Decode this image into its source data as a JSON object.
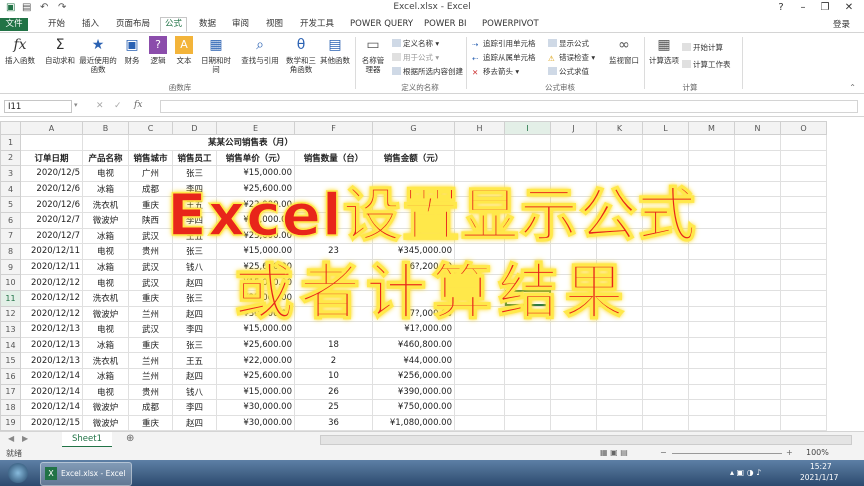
{
  "window": {
    "title": "Excel.xlsx - Excel",
    "login": "登录"
  },
  "tabs": [
    "文件",
    "开始",
    "插入",
    "页面布局",
    "公式",
    "数据",
    "审阅",
    "视图",
    "开发工具",
    "POWER QUERY",
    "POWER BI",
    "POWERPIVOT"
  ],
  "ribbon": {
    "insert_function": "插入函数",
    "autosum": "自动求和",
    "recent": "最近使用的函数",
    "financial": "财务",
    "logical": "逻辑",
    "text": "文本",
    "datetime": "日期和时间",
    "lookup": "查找与引用",
    "math": "数学和三角函数",
    "more": "其他函数",
    "name_manager": "名称管理器",
    "define_name": "定义名称",
    "use_in_formula": "用于公式",
    "create_from_selection": "根据所选内容创建",
    "trace_precedents": "追踪引用单元格",
    "trace_dependents": "追踪从属单元格",
    "remove_arrows": "移去箭头",
    "show_formulas": "显示公式",
    "error_checking": "错误检查",
    "evaluate_formula": "公式求值",
    "watch_window": "监视窗口",
    "calc_options": "计算选项",
    "calc_now": "开始计算",
    "calc_sheet": "计算工作表",
    "group_library": "函数库",
    "group_names": "定义的名称",
    "group_audit": "公式审核",
    "group_calc": "计算"
  },
  "formula_bar": {
    "name_box": "I11",
    "fx": "fx",
    "value": ""
  },
  "columns": [
    "A",
    "B",
    "C",
    "D",
    "E",
    "F",
    "G",
    "H",
    "I",
    "J",
    "K",
    "L",
    "M",
    "N",
    "O"
  ],
  "sheet": {
    "title": "某某公司销售表（月）",
    "headers": [
      "订单日期",
      "产品名称",
      "销售城市",
      "销售员工",
      "销售单价（元）",
      "销售数量（台）",
      "销售金额（元）"
    ],
    "rows": [
      [
        "2020/12/5",
        "电视",
        "广州",
        "张三",
        "¥15,000.00",
        "",
        ""
      ],
      [
        "2020/12/6",
        "冰箱",
        "成都",
        "李四",
        "¥25,600.00",
        "",
        ""
      ],
      [
        "2020/12/6",
        "洗衣机",
        "重庆",
        "王五",
        "¥22,000.00",
        "",
        ""
      ],
      [
        "2020/12/7",
        "微波炉",
        "陕西",
        "李四",
        "¥30,000.00",
        "",
        ""
      ],
      [
        "2020/12/7",
        "冰箱",
        "武汉",
        "王五",
        "¥25,600.00",
        "",
        ""
      ],
      [
        "2020/12/11",
        "电视",
        "贵州",
        "张三",
        "¥15,000.00",
        "23",
        "¥345,000.00"
      ],
      [
        "2020/12/11",
        "冰箱",
        "武汉",
        "钱八",
        "¥25,600.00",
        "",
        "¥6?,200.00"
      ],
      [
        "2020/12/12",
        "电视",
        "武汉",
        "赵四",
        "¥15,000.00",
        "",
        ""
      ],
      [
        "2020/12/12",
        "洗衣机",
        "重庆",
        "张三",
        "¥22,000.00",
        "",
        ""
      ],
      [
        "2020/12/12",
        "微波炉",
        "兰州",
        "赵四",
        "¥30,000.00",
        "",
        "¥7?,000.00"
      ],
      [
        "2020/12/13",
        "电视",
        "武汉",
        "李四",
        "¥15,000.00",
        "",
        "¥1?,000.00"
      ],
      [
        "2020/12/13",
        "冰箱",
        "重庆",
        "张三",
        "¥25,600.00",
        "18",
        "¥460,800.00"
      ],
      [
        "2020/12/13",
        "洗衣机",
        "兰州",
        "王五",
        "¥22,000.00",
        "2",
        "¥44,000.00"
      ],
      [
        "2020/12/14",
        "冰箱",
        "兰州",
        "赵四",
        "¥25,600.00",
        "10",
        "¥256,000.00"
      ],
      [
        "2020/12/14",
        "电视",
        "贵州",
        "钱八",
        "¥15,000.00",
        "26",
        "¥390,000.00"
      ],
      [
        "2020/12/14",
        "微波炉",
        "成都",
        "李四",
        "¥30,000.00",
        "25",
        "¥750,000.00"
      ],
      [
        "2020/12/15",
        "微波炉",
        "重庆",
        "赵四",
        "¥30,000.00",
        "36",
        "¥1,080,000.00"
      ],
      [
        "2020/12/15",
        "电视",
        "重庆",
        "张三",
        "¥15,000.00",
        "40",
        "¥600,000.00"
      ],
      [
        "2020/12/16",
        "微波炉",
        "武汉",
        "赵四",
        "¥30,000.00",
        "42",
        "¥1,260,000.00"
      ]
    ]
  },
  "overlay": {
    "line1": "Excel设置显示公式",
    "line2": "或者计算结果"
  },
  "sheet_tab": "Sheet1",
  "status": {
    "ready": "就绪",
    "zoom": "100%"
  },
  "taskbar": {
    "app": "Excel.xlsx - Excel",
    "time": "15:27",
    "date": "2021/1/17"
  },
  "colors": {
    "excel_green": "#217346",
    "overlay_red": "#e8251a",
    "overlay_glow": "#ffe84a"
  }
}
